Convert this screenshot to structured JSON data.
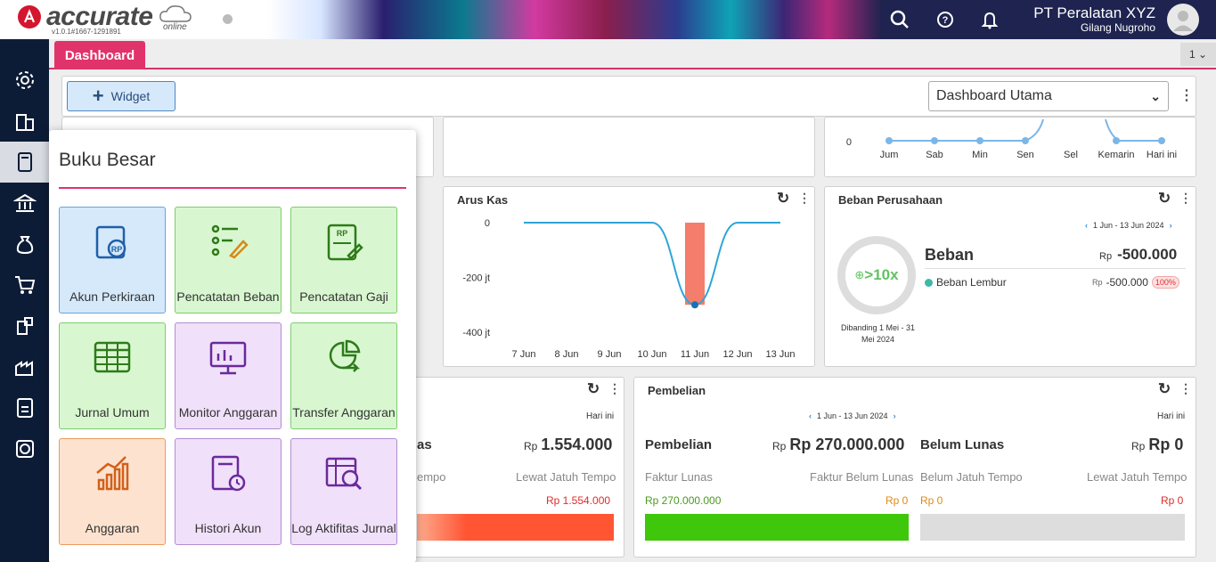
{
  "header": {
    "logo_text": "accurate",
    "logo_online": "online",
    "version": "v1.0.1#1667-1291891",
    "company": "PT Peralatan XYZ",
    "user": "Gilang Nugroho"
  },
  "tabs": {
    "active": "Dashboard",
    "page_indicator": "1"
  },
  "toolbar": {
    "widget_label": "Widget",
    "dashboard_select": "Dashboard Utama"
  },
  "top_chart": {
    "y_zero": "0",
    "x_labels": [
      "Jum",
      "Sab",
      "Min",
      "Sen",
      "Sel",
      "Kemarin",
      "Hari ini"
    ]
  },
  "arus_kas": {
    "title": "Arus Kas",
    "y_labels": [
      "0",
      "-200 jt",
      "-400 jt"
    ],
    "x_labels": [
      "7 Jun",
      "8 Jun",
      "9 Jun",
      "10 Jun",
      "11 Jun",
      "12 Jun",
      "13 Jun"
    ]
  },
  "chart_data": {
    "type": "line",
    "title": "Arus Kas",
    "categories": [
      "7 Jun",
      "8 Jun",
      "9 Jun",
      "10 Jun",
      "11 Jun",
      "12 Jun",
      "13 Jun"
    ],
    "ylim": [
      -400,
      0
    ],
    "series": [
      {
        "values": [
          0,
          0,
          0,
          0,
          -300,
          0,
          0
        ]
      }
    ],
    "bar_values": [
      0,
      0,
      0,
      0,
      -300,
      0,
      0
    ],
    "colors": {
      "line": "#2ea5d6",
      "bar": "#f47d6b"
    }
  },
  "beban": {
    "title": "Beban Perusahaan",
    "range": "1 Jun - 13 Jun 2024",
    "ring_value": ">10x",
    "compare": "Dibanding 1 Mei - 31 Mei 2024",
    "label": "Beban",
    "currency": "Rp",
    "total": "-500.000",
    "item_name": "Beban Lembur",
    "item_value": "-500.000",
    "item_pct": "100%"
  },
  "penjualan": {
    "hari_ini": "Hari ini",
    "label_partial": "as",
    "currency": "Rp",
    "value": "1.554.000",
    "col1_partial": "empo",
    "col2": "Lewat Jatuh Tempo",
    "col2_value": "Rp 1.554.000"
  },
  "pembelian": {
    "title": "Pembelian",
    "range": "1 Jun - 13 Jun 2024",
    "hari_ini": "Hari ini",
    "label": "Pembelian",
    "currency": "Rp",
    "value": "Rp 270.000.000",
    "belum_label": "Belum Lunas",
    "belum_value": "Rp 0",
    "faktur_lunas": "Faktur Lunas",
    "faktur_belum": "Faktur Belum Lunas",
    "belum_jatuh": "Belum Jatuh Tempo",
    "lewat_jatuh": "Lewat Jatuh Tempo",
    "v_lunas": "Rp 270.000.000",
    "v_belum": "Rp 0",
    "v_belum_jatuh": "Rp 0",
    "v_lewat": "Rp 0"
  },
  "popup": {
    "title": "Buku Besar",
    "tiles": [
      {
        "label": "Akun Perkiraan"
      },
      {
        "label": "Pencatatan Beban"
      },
      {
        "label": "Pencatatan Gaji"
      },
      {
        "label": "Jurnal Umum"
      },
      {
        "label": "Monitor Anggaran"
      },
      {
        "label": "Transfer Anggaran"
      },
      {
        "label": "Anggaran"
      },
      {
        "label": "Histori Akun"
      },
      {
        "label": "Log Aktifitas Jurnal"
      }
    ]
  },
  "icons": {
    "search": "search-icon",
    "help": "help-icon",
    "bell": "bell-icon",
    "sidebar": [
      "gear-icon",
      "building-icon",
      "book-icon",
      "bank-icon",
      "money-bag-icon",
      "cart-icon",
      "inventory-icon",
      "factory-icon",
      "tax-icon",
      "report-icon"
    ]
  }
}
